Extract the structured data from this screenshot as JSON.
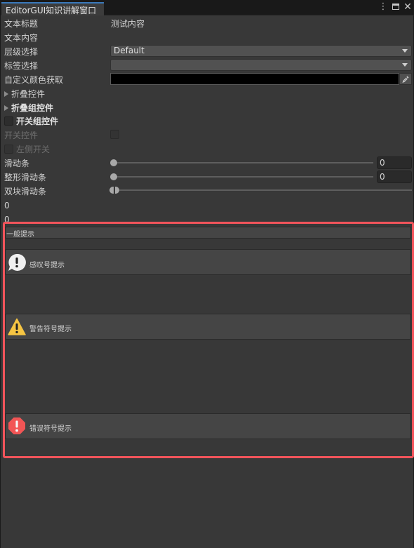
{
  "window": {
    "tab_title": "EditorGUI知识讲解窗口",
    "menu_icon": "kebab-menu-icon",
    "maximize_icon": "maximize-icon",
    "close_glyph": "✕"
  },
  "fields": {
    "text_title_label": "文本标题",
    "text_title_value": "测试内容",
    "text_content_label": "文本内容",
    "layer_label": "层级选择",
    "layer_value": "Default",
    "tag_label": "标签选择",
    "tag_value": "",
    "color_label": "自定义颜色获取",
    "color_value": "#000000",
    "foldout_label": "折叠控件",
    "foldout_group_label": "折叠组控件",
    "toggle_group_label": "开关组控件",
    "toggle_label": "开关控件",
    "left_toggle_label": "左侧开关",
    "slider_label": "滑动条",
    "slider_value": "0",
    "int_slider_label": "整形滑动条",
    "int_slider_value": "0",
    "minmax_label": "双块滑动条",
    "min_value": "0",
    "max_value": "0"
  },
  "help_boxes": {
    "info_text": "一般提示",
    "exclaim_text": "感叹号提示",
    "warning_text": "警告符号提示",
    "error_text": "错误符号提示"
  },
  "colors": {
    "highlight": "#f2545b",
    "warning": "#f6c543",
    "error": "#f25555",
    "accent": "#3a79bb"
  }
}
